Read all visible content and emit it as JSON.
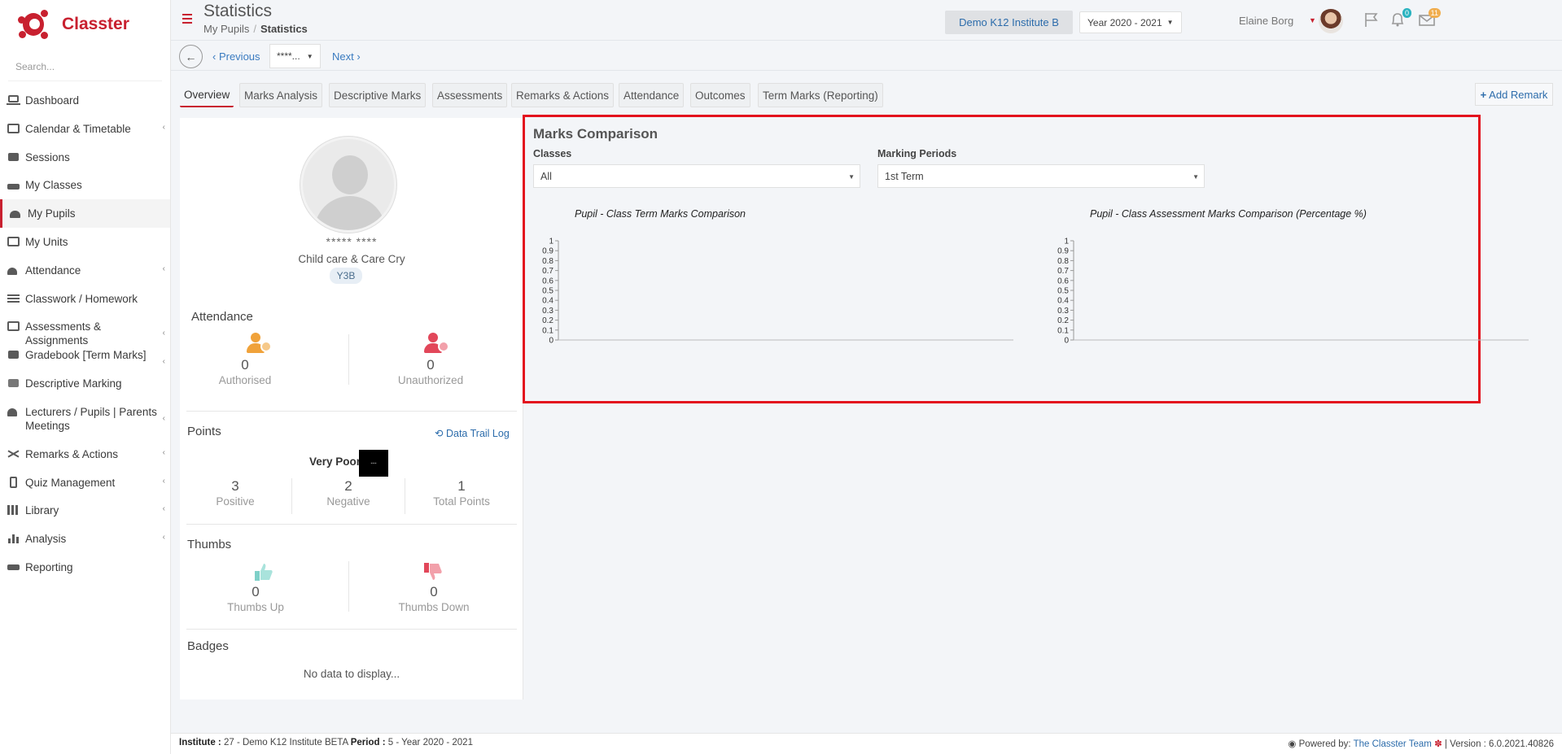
{
  "app": {
    "name": "Classter",
    "brand_color": "#c8202f"
  },
  "sidebar": {
    "search_placeholder": "Search...",
    "items": [
      {
        "label": "Dashboard",
        "icon": "laptop-icon",
        "has_submenu": false
      },
      {
        "label": "Calendar & Timetable",
        "icon": "calendar-icon",
        "has_submenu": true
      },
      {
        "label": "Sessions",
        "icon": "presentation-icon",
        "has_submenu": false
      },
      {
        "label": "My Classes",
        "icon": "group-icon",
        "has_submenu": false
      },
      {
        "label": "My Pupils",
        "icon": "users-icon",
        "has_submenu": false,
        "active": true
      },
      {
        "label": "My Units",
        "icon": "book-icon",
        "has_submenu": false
      },
      {
        "label": "Attendance",
        "icon": "user-clock-icon",
        "has_submenu": true
      },
      {
        "label": "Classwork / Homework",
        "icon": "list-icon",
        "has_submenu": false
      },
      {
        "label": "Assessments & Assignments",
        "icon": "edit-icon",
        "has_submenu": true
      },
      {
        "label": "Gradebook [Term Marks]",
        "icon": "gradebook-icon",
        "has_submenu": true
      },
      {
        "label": "Descriptive Marking",
        "icon": "descriptive-icon",
        "has_submenu": false
      },
      {
        "label": "Lecturers / Pupils | Parents Meetings",
        "icon": "meeting-icon",
        "has_submenu": true
      },
      {
        "label": "Remarks & Actions",
        "icon": "shuffle-icon",
        "has_submenu": true
      },
      {
        "label": "Quiz Management",
        "icon": "quiz-icon",
        "has_submenu": true
      },
      {
        "label": "Library",
        "icon": "library-icon",
        "has_submenu": true
      },
      {
        "label": "Analysis",
        "icon": "bar-chart-icon",
        "has_submenu": true
      },
      {
        "label": "Reporting",
        "icon": "printer-icon",
        "has_submenu": false
      }
    ]
  },
  "header": {
    "title": "Statistics",
    "breadcrumb": [
      "My Pupils",
      "Statistics"
    ],
    "institute": "Demo K12 Institute B",
    "year": "Year 2020 - 2021",
    "notifications_count": "0",
    "messages_count": "11",
    "user_name": "Elaine Borg"
  },
  "toolbar": {
    "previous": "Previous",
    "pupil_select": "****...",
    "next": "Next"
  },
  "tabs": [
    {
      "label": "Overview",
      "active": true
    },
    {
      "label": "Marks Analysis"
    },
    {
      "label": "Descriptive Marks"
    },
    {
      "label": "Assessments"
    },
    {
      "label": "Remarks & Actions"
    },
    {
      "label": "Attendance"
    },
    {
      "label": "Outcomes"
    },
    {
      "label": "Term Marks (Reporting)"
    }
  ],
  "add_remark": "Add Remark",
  "pupil": {
    "name": "***** ****",
    "course": "Child care & Care Cry",
    "class": "Y3B"
  },
  "attendance": {
    "title": "Attendance",
    "authorised": {
      "value": "0",
      "label": "Authorised"
    },
    "unauthorized": {
      "value": "0",
      "label": "Unauthorized"
    }
  },
  "points": {
    "title": "Points",
    "trail_link": "Data Trail Log",
    "rating": "Very Poor",
    "positive": {
      "value": "3",
      "label": "Positive"
    },
    "negative": {
      "value": "2",
      "label": "Negative"
    },
    "total": {
      "value": "1",
      "label": "Total Points"
    }
  },
  "thumbs": {
    "title": "Thumbs",
    "up": {
      "value": "0",
      "label": "Thumbs Up"
    },
    "down": {
      "value": "0",
      "label": "Thumbs Down"
    }
  },
  "badges": {
    "title": "Badges",
    "empty": "No data to display..."
  },
  "marks_comparison": {
    "title": "Marks Comparison",
    "classes_label": "Classes",
    "classes_value": "All",
    "periods_label": "Marking Periods",
    "periods_value": "1st Term"
  },
  "chart_data": [
    {
      "type": "bar",
      "title": "Pupil - Class Term Marks Comparison",
      "categories": [],
      "series": [],
      "ylim": [
        0,
        1
      ],
      "yticks": [
        "0",
        "0.1",
        "0.2",
        "0.3",
        "0.4",
        "0.5",
        "0.6",
        "0.7",
        "0.8",
        "0.9",
        "1"
      ]
    },
    {
      "type": "bar",
      "title": "Pupil - Class Assessment Marks Comparison (Percentage %)",
      "categories": [],
      "series": [],
      "ylim": [
        0,
        1
      ],
      "yticks": [
        "0",
        "0.1",
        "0.2",
        "0.3",
        "0.4",
        "0.5",
        "0.6",
        "0.7",
        "0.8",
        "0.9",
        "1"
      ]
    }
  ],
  "footer": {
    "institute_label": "Institute :",
    "institute_value": "27 - Demo K12 Institute BETA",
    "period_label": "Period :",
    "period_value": "5 - Year 2020 - 2021",
    "powered_by": "Powered by:",
    "team_link": "The Classter Team",
    "version": "| Version : 6.0.2021.40826"
  }
}
